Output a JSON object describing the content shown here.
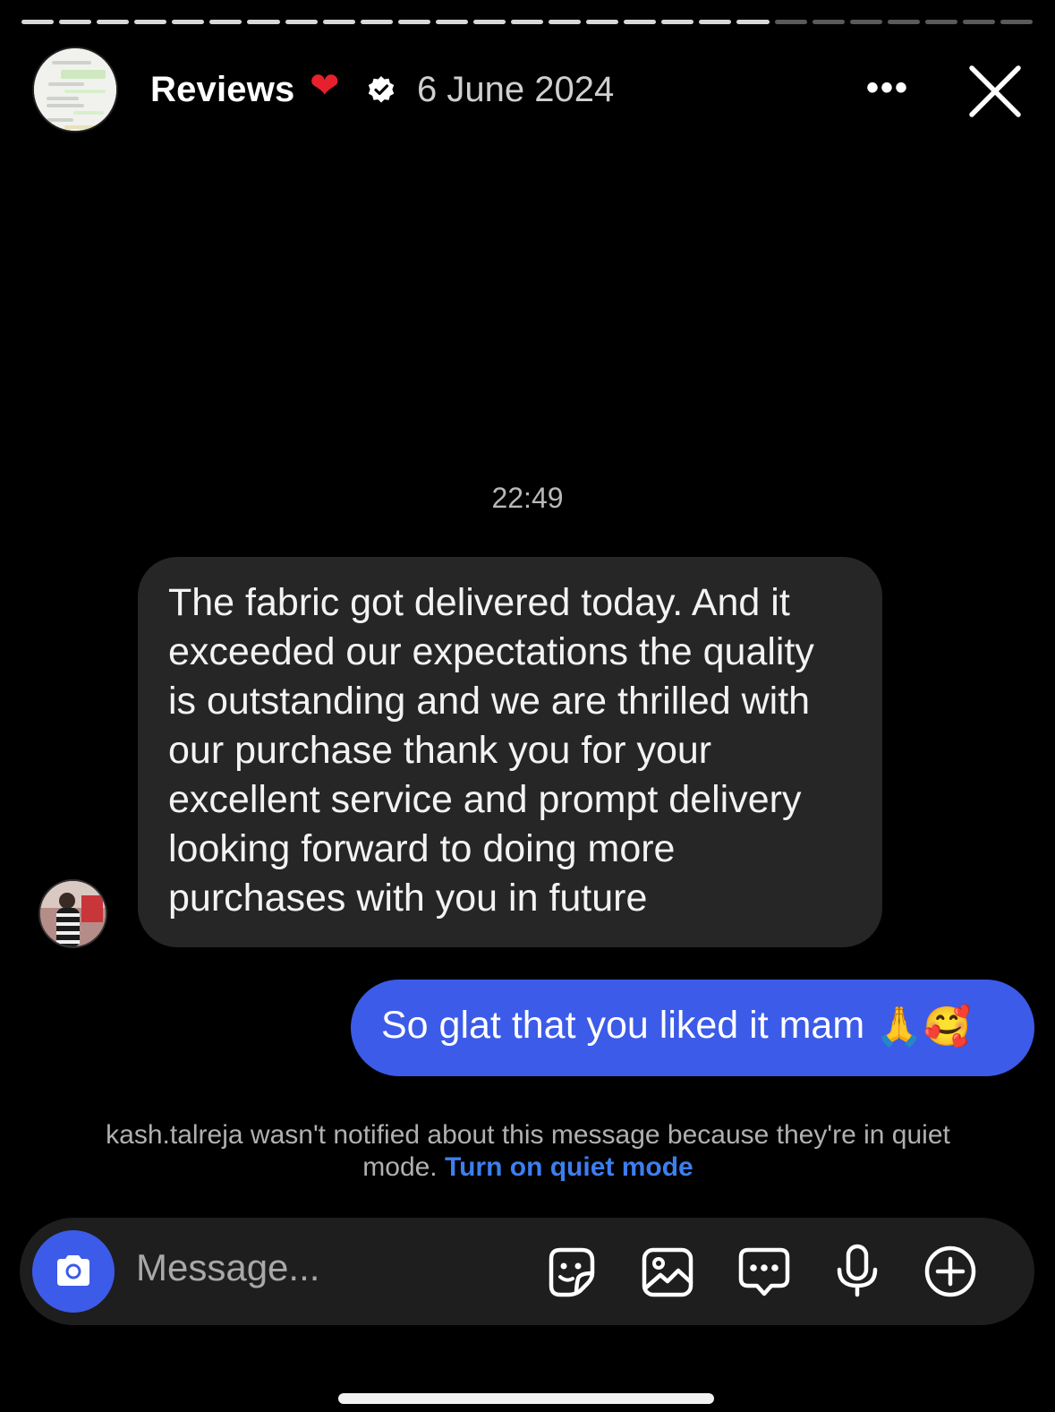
{
  "story": {
    "progress": {
      "total_segments": 27,
      "viewed_segments": 20
    }
  },
  "header": {
    "title": "Reviews",
    "heart_icon": "red-heart-emoji",
    "verified_icon": "verified-badge-icon",
    "date": "6 June 2024",
    "more_icon": "more-horizontal-icon",
    "more_label": "•••",
    "close_icon": "close-icon"
  },
  "chat": {
    "timestamp": "22:49",
    "incoming_message": "The fabric got delivered today. And it exceeded our expectations the quality is outstanding and we are thrilled with our purchase thank you for your excellent service and prompt delivery looking forward to doing more purchases with you in future",
    "outgoing_message": "So glat that you liked it mam",
    "outgoing_emojis": "🙏🥰"
  },
  "notice": {
    "text": "kash.talreja wasn't notified about this message because they're in quiet mode. ",
    "link": "Turn on quiet mode"
  },
  "composer": {
    "placeholder": "Message...",
    "icons": [
      "camera-icon",
      "sticker-icon",
      "gallery-icon",
      "chat-options-icon",
      "microphone-icon",
      "add-icon"
    ]
  },
  "colors": {
    "accent_blue": "#3c5be8",
    "link_blue": "#3d7ef0",
    "incoming_bubble": "#262626",
    "background": "#000000"
  }
}
